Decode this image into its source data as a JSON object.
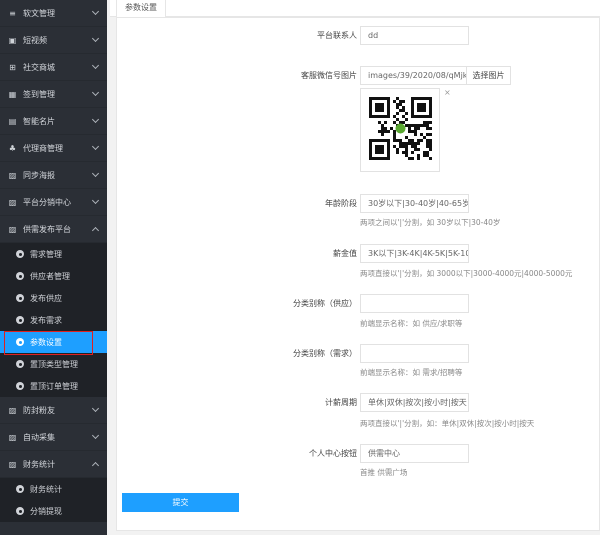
{
  "sidebar": {
    "groups_top": [
      {
        "icon": "list-icon",
        "label": "软文管理"
      },
      {
        "icon": "video-icon",
        "label": "短视频"
      },
      {
        "icon": "cart-icon",
        "label": "社交商城"
      },
      {
        "icon": "checkin-icon",
        "label": "签到管理"
      },
      {
        "icon": "card-icon",
        "label": "智能名片"
      },
      {
        "icon": "agent-icon",
        "label": "代理商管理"
      },
      {
        "icon": "image-icon",
        "label": "同步海报"
      },
      {
        "icon": "image-icon",
        "label": "平台分销中心"
      },
      {
        "icon": "image-icon",
        "label": "供需发布平台"
      }
    ],
    "sub_items_1": [
      {
        "label": "需求管理"
      },
      {
        "label": "供应者管理"
      },
      {
        "label": "发布供应"
      },
      {
        "label": "发布需求"
      },
      {
        "label": "参数设置",
        "active": true
      },
      {
        "label": "置顶类型管理"
      },
      {
        "label": "置顶订单管理"
      }
    ],
    "groups_mid": [
      {
        "icon": "image-icon",
        "label": "防封粉友"
      },
      {
        "icon": "image-icon",
        "label": "自动采集"
      },
      {
        "icon": "image-icon",
        "label": "财务统计"
      }
    ],
    "sub_items_2": [
      {
        "label": "财务统计"
      },
      {
        "label": "分销提现"
      }
    ]
  },
  "tab": {
    "label": "参数设置"
  },
  "form": {
    "contact_label": "平台联系人",
    "contact_value": "dd",
    "wechat_label": "客服微信号图片",
    "wechat_value": "images/39/2020/08/qMjkLK",
    "upload_label": "选择图片",
    "close_label": "×",
    "age_label": "年龄阶段",
    "age_value": "30岁以下|30-40岁|40-65岁|6",
    "age_hint": "两项之间以'|'分割，如 30岁以下|30-40岁",
    "salary_label": "薪金值",
    "salary_value": "3K以下|3K-4K|4K-5K|5K-10",
    "salary_hint": "两项直接以'|'分割，如 3000以下|3000-4000元|4000-5000元",
    "supply_alias_label": "分类别称（供应）",
    "supply_alias_value": "",
    "supply_alias_hint": "前端显示名称：如 供应/求职等",
    "demand_alias_label": "分类别称（需求）",
    "demand_alias_value": "",
    "demand_alias_hint": "前端显示名称：如 需求/招聘等",
    "period_label": "计薪周期",
    "period_value": "单休|双休|按次|按小时|按天",
    "period_hint": "两项直接以'|'分割，如：单休|双休|按次|按小时|按天",
    "center_label": "个人中心按钮",
    "center_value": "供需中心",
    "center_hint": "首推 供需广场",
    "submit_label": "提交"
  }
}
